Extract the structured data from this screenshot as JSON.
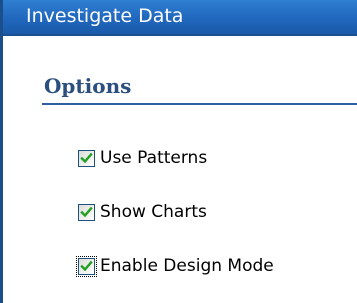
{
  "window": {
    "title": "Investigate Data"
  },
  "section": {
    "title": "Options"
  },
  "options": [
    {
      "label": "Use Patterns",
      "checked": true,
      "icon": "check-icon"
    },
    {
      "label": "Show Charts",
      "checked": true,
      "icon": "check-icon"
    },
    {
      "label": "Enable Design Mode",
      "checked": true,
      "focused": true,
      "icon": "check-icon"
    }
  ],
  "colors": {
    "titlebar": "#2067be",
    "section_title": "#2b4f7e",
    "rule": "#2f5fa0",
    "check": "#21a121"
  }
}
